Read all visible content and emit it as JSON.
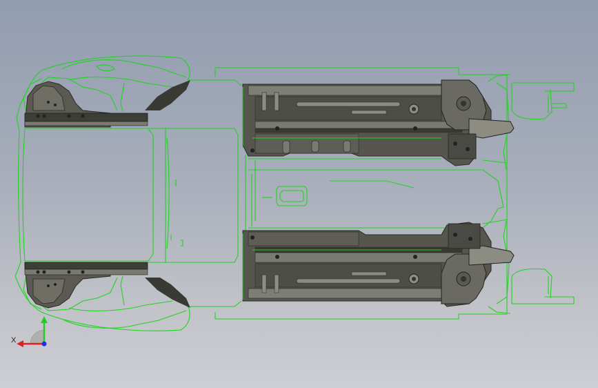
{
  "viewport": {
    "background_top": "#929cb0",
    "background_bottom": "#cdcfd4",
    "edge_color": "#1ed41e",
    "solid_color": "#56564f",
    "solid_dark": "#2f302c",
    "solid_light": "#8a8a80"
  },
  "triad": {
    "x_label": "X",
    "x_color": "#e0201c",
    "y_color": "#22cc22",
    "z_color": "#2030e0",
    "plane_color": "#b0b0b0"
  }
}
